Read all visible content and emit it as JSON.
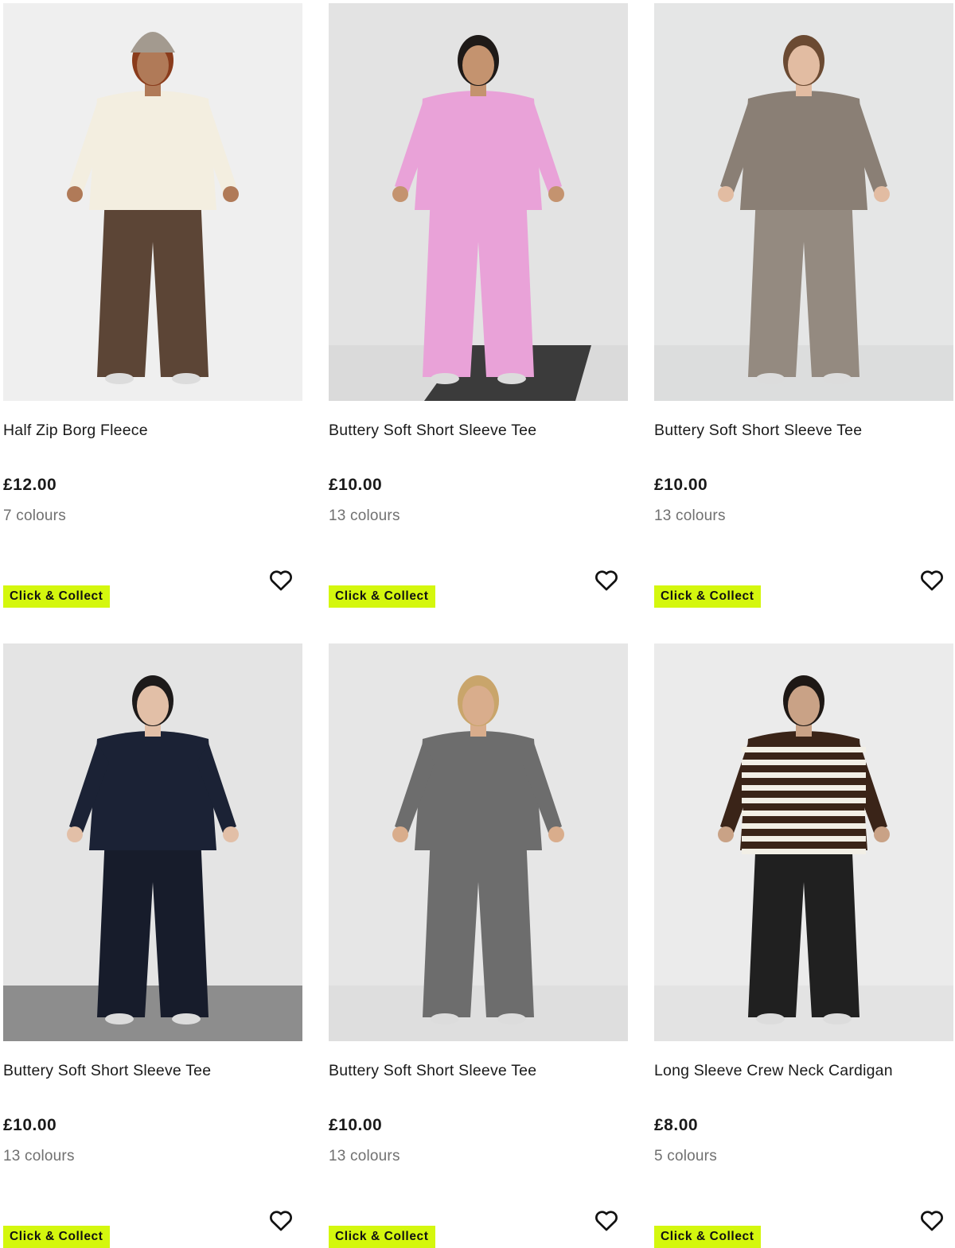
{
  "products": [
    {
      "name": "Half Zip Borg Fleece",
      "price": "£12.00",
      "colours": "7 colours",
      "badge": "Click & Collect",
      "image": {
        "bg": "#efefef",
        "floor": "#efefef",
        "skin": "#b07a58",
        "hair": "#8a3c1c",
        "top": "#f3eee0",
        "bottom": "#5c4536",
        "hat": "#a39a8f",
        "mat": ""
      }
    },
    {
      "name": "Buttery Soft Short Sleeve Tee",
      "price": "£10.00",
      "colours": "13 colours",
      "badge": "Click & Collect",
      "image": {
        "bg": "#e3e3e3",
        "floor": "#dadada",
        "skin": "#c4936f",
        "hair": "#1e1a18",
        "top": "#e9a2d8",
        "bottom": "#e9a2d8",
        "hat": "",
        "mat": "#3b3b3b"
      }
    },
    {
      "name": "Buttery Soft Short Sleeve Tee",
      "price": "£10.00",
      "colours": "13 colours",
      "badge": "Click & Collect",
      "image": {
        "bg": "#e5e6e6",
        "floor": "#dcdddd",
        "skin": "#e2bca2",
        "hair": "#6b4a32",
        "top": "#8a7f75",
        "bottom": "#948a80",
        "hat": "",
        "mat": ""
      }
    },
    {
      "name": "Buttery Soft Short Sleeve Tee",
      "price": "£10.00",
      "colours": "13 colours",
      "badge": "Click & Collect",
      "image": {
        "bg": "#e4e4e4",
        "floor": "#8d8d8d",
        "skin": "#e2bfa7",
        "hair": "#1d1a1a",
        "top": "#1b2235",
        "bottom": "#171c2b",
        "hat": "",
        "mat": ""
      }
    },
    {
      "name": "Buttery Soft Short Sleeve Tee",
      "price": "£10.00",
      "colours": "13 colours",
      "badge": "Click & Collect",
      "image": {
        "bg": "#e6e6e6",
        "floor": "#dedede",
        "skin": "#d9ad8c",
        "hair": "#c9a56b",
        "top": "#6d6d6d",
        "bottom": "#6d6d6d",
        "hat": "",
        "mat": ""
      }
    },
    {
      "name": "Long Sleeve Crew Neck Cardigan",
      "price": "£8.00",
      "colours": "5 colours",
      "badge": "Click & Collect",
      "image": {
        "bg": "#ebebeb",
        "floor": "#e3e3e3",
        "skin": "#c9a286",
        "hair": "#1e1815",
        "top": "#3a2418",
        "bottom": "#202020",
        "hat": "",
        "mat": ""
      }
    }
  ],
  "icons": {
    "favourite": "heart-outline-icon"
  },
  "colors": {
    "badge": "#d4f70e",
    "text": "#1a1a1a",
    "muted": "#707070"
  }
}
